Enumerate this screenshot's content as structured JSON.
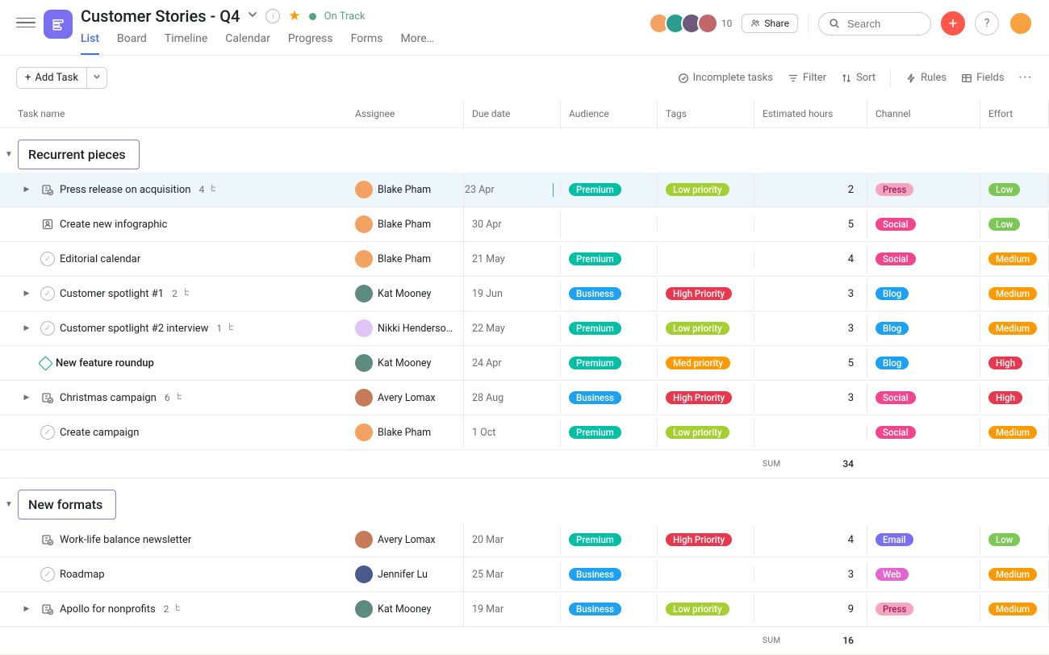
{
  "project": {
    "title": "Customer Stories - Q4",
    "status_label": "On Track"
  },
  "tabs": [
    "List",
    "Board",
    "Timeline",
    "Calendar",
    "Progress",
    "Forms",
    "More…"
  ],
  "topright": {
    "avatar_count": "10",
    "share": "Share",
    "search_placeholder": "Search"
  },
  "toolbar": {
    "add_task": "Add Task",
    "incomplete": "Incomplete tasks",
    "filter": "Filter",
    "sort": "Sort",
    "rules": "Rules",
    "fields": "Fields"
  },
  "columns": {
    "name": "Task name",
    "assignee": "Assignee",
    "due": "Due date",
    "audience": "Audience",
    "tags": "Tags",
    "est": "Estimated hours",
    "channel": "Channel",
    "effort": "Effort"
  },
  "sections": {
    "s1": {
      "title": "Recurrent pieces",
      "sum_label": "SUM",
      "sum_val": "34"
    },
    "s2": {
      "title": "New formats",
      "sum_label": "SUM",
      "sum_val": "16"
    }
  },
  "assignees": {
    "blake": "Blake Pham",
    "kat": "Kat Mooney",
    "nikki": "Nikki Henderson …",
    "avery": "Avery Lomax",
    "jennifer": "Jennifer Lu"
  },
  "tasks": {
    "t1": {
      "name": "Press release on acquisition",
      "sub": "4",
      "due": "23 Apr",
      "aud": "Premium",
      "tag": "Low priority",
      "est": "2",
      "chan": "Press",
      "eff": "Low"
    },
    "t2": {
      "name": "Create new infographic",
      "due": "30 Apr",
      "est": "5",
      "chan": "Social",
      "eff": "Low"
    },
    "t3": {
      "name": "Editorial calendar",
      "due": "21 May",
      "aud": "Premium",
      "est": "4",
      "chan": "Social",
      "eff": "Medium"
    },
    "t4": {
      "name": "Customer spotlight #1",
      "sub": "2",
      "due": "19 Jun",
      "aud": "Business",
      "tag": "High Priority",
      "est": "3",
      "chan": "Blog",
      "eff": "Medium"
    },
    "t5": {
      "name": "Customer spotlight #2 interview",
      "sub": "1",
      "due": "22 May",
      "aud": "Premium",
      "tag": "Low priority",
      "est": "3",
      "chan": "Blog",
      "eff": "Medium"
    },
    "t6": {
      "name": "New feature roundup",
      "due": "24 Apr",
      "aud": "Premium",
      "tag": "Med priority",
      "est": "5",
      "chan": "Blog",
      "eff": "High"
    },
    "t7": {
      "name": "Christmas campaign",
      "sub": "6",
      "due": "28 Aug",
      "aud": "Business",
      "tag": "High Priority",
      "est": "3",
      "chan": "Social",
      "eff": "High"
    },
    "t8": {
      "name": "Create campaign",
      "due": "1 Oct",
      "aud": "Premium",
      "tag": "Low priority",
      "chan": "Social",
      "eff": "Medium"
    },
    "t9": {
      "name": "Work-life balance newsletter",
      "due": "20 Mar",
      "aud": "Premium",
      "tag": "High Priority",
      "est": "4",
      "chan": "Email",
      "eff": "Low"
    },
    "t10": {
      "name": "Roadmap",
      "due": "25 Mar",
      "aud": "Business",
      "est": "3",
      "chan": "Web",
      "eff": "Medium"
    },
    "t11": {
      "name": "Apollo for nonprofits",
      "sub": "2",
      "due": "19 Mar",
      "aud": "Business",
      "tag": "Low priority",
      "est": "9",
      "chan": "Press",
      "eff": "Medium"
    }
  }
}
